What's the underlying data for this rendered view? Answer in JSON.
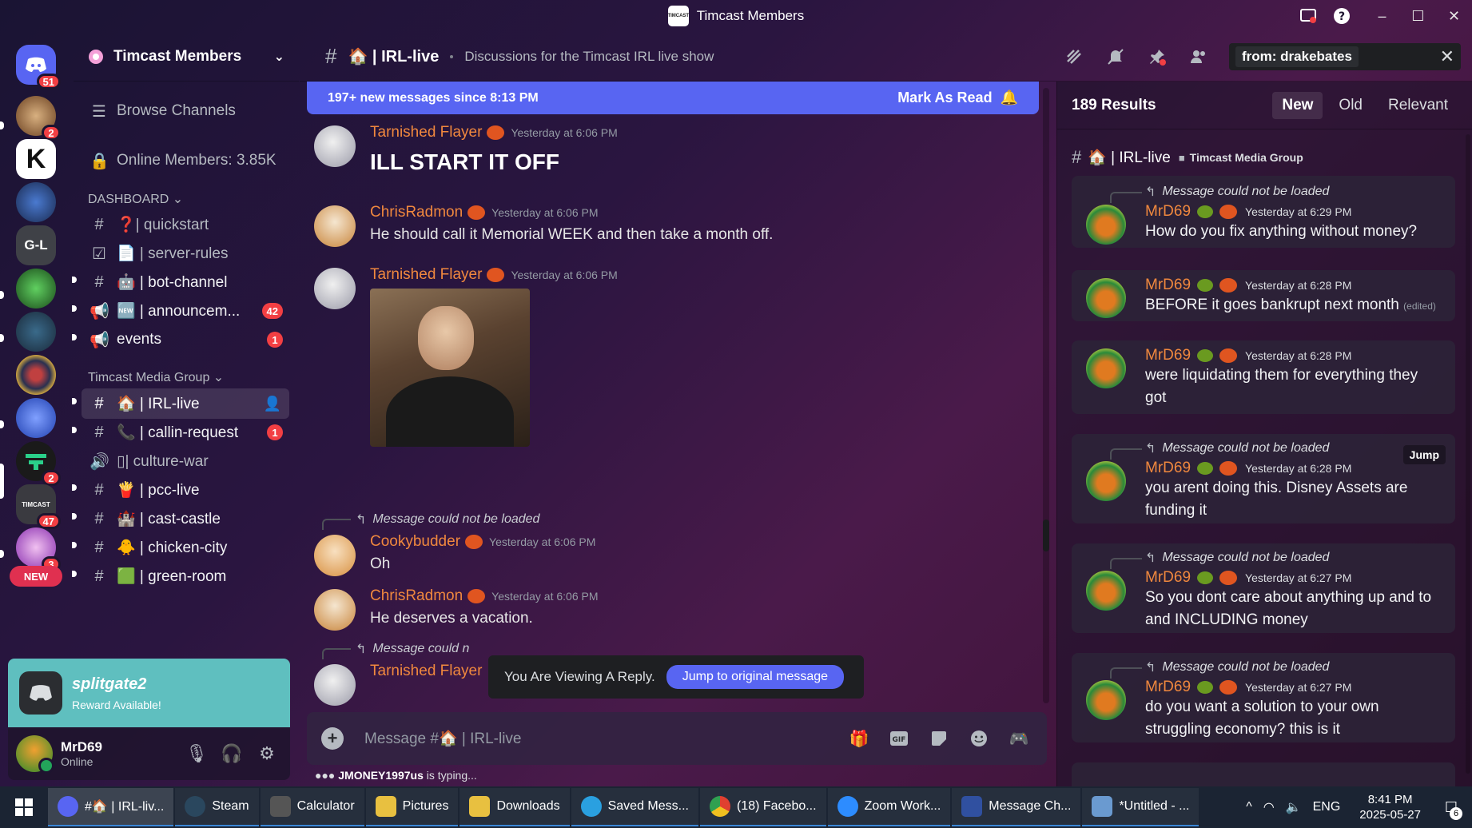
{
  "window": {
    "title": "Timcast Members",
    "logo_text": "TIMCAST",
    "minimize": "–",
    "maximize": "☐",
    "close": "✕"
  },
  "servers": [
    {
      "name": "direct-messages",
      "label": "",
      "badge": "51",
      "color": "#5865f2"
    },
    {
      "name": "server-2",
      "label": "",
      "badge": "2",
      "color": "#8a6a40"
    },
    {
      "name": "server-k",
      "label": "K",
      "badge": "",
      "color": "#ffffff"
    },
    {
      "name": "server-4",
      "label": "",
      "badge": "",
      "color": "#3a5aa0"
    },
    {
      "name": "server-gl",
      "label": "G-L",
      "badge": "",
      "color": "#3f4147"
    },
    {
      "name": "server-alien",
      "label": "",
      "badge": "",
      "color": "#2a7a3a"
    },
    {
      "name": "server-7",
      "label": "",
      "badge": "",
      "color": "#2a4a6a"
    },
    {
      "name": "server-8",
      "label": "",
      "badge": "",
      "color": "#2a3050"
    },
    {
      "name": "server-9",
      "label": "",
      "badge": "",
      "color": "#3050c0"
    },
    {
      "name": "server-10",
      "label": "",
      "badge": "2",
      "color": "#1a1a1a"
    },
    {
      "name": "server-timcast",
      "label": "TIMCAST",
      "badge": "47",
      "color": "#3a3a40"
    },
    {
      "name": "server-12",
      "label": "",
      "badge": "3",
      "color": "#a040c0"
    },
    {
      "name": "server-new",
      "label": "NEW",
      "badge": "",
      "color": "#e03050"
    }
  ],
  "sidebar": {
    "guild_name": "Timcast Members",
    "browse": "Browse Channels",
    "online_members": "Online Members: 3.85K",
    "category_dashboard": "DASHBOARD ⌄",
    "category_media": "Timcast Media Group ⌄",
    "channels": [
      {
        "icon": "#",
        "label": "❓| quickstart",
        "badge": ""
      },
      {
        "icon": "☑",
        "label": "📄 | server-rules",
        "badge": ""
      },
      {
        "icon": "#",
        "label": "🤖 | bot-channel",
        "badge": ""
      },
      {
        "icon": "📢",
        "label": "🆕 | announcem...",
        "badge": "42"
      },
      {
        "icon": "📢",
        "label": "events",
        "badge": "1"
      },
      {
        "icon": "#",
        "label": "🏠 | IRL-live",
        "badge": ""
      },
      {
        "icon": "#",
        "label": "📞 | callin-request",
        "badge": "1"
      },
      {
        "icon": "🔊",
        "label": "▯| culture-war",
        "badge": ""
      },
      {
        "icon": "#",
        "label": "🍟 | pcc-live",
        "badge": ""
      },
      {
        "icon": "#",
        "label": "🏰 | cast-castle",
        "badge": ""
      },
      {
        "icon": "#",
        "label": "🐥 | chicken-city",
        "badge": ""
      },
      {
        "icon": "#",
        "label": "🟩 | green-room",
        "badge": ""
      }
    ]
  },
  "promo": {
    "title": "splitgate2",
    "subtitle": "Reward Available!"
  },
  "user": {
    "name": "MrD69",
    "status": "Online"
  },
  "chat": {
    "channel": "🏠 | IRL-live",
    "topic": "Discussions for the Timcast IRL live show",
    "search_chip": "from: drakebates",
    "new_messages": "197+ new messages since 8:13 PM",
    "mark_read": "Mark As Read",
    "messages": [
      {
        "author": "Tarnished Flayer",
        "time": "Yesterday at 6:06 PM",
        "text": "ILL START IT OFF"
      },
      {
        "author": "ChrisRadmon",
        "time": "Yesterday at 6:06 PM",
        "text": "He should call it Memorial WEEK and then take a month off."
      },
      {
        "author": "Tarnished Flayer",
        "time": "Yesterday at 6:06 PM",
        "text": ""
      },
      {
        "reply": "Message could not be loaded",
        "author": "Cookybudder",
        "time": "Yesterday at 6:06 PM",
        "text": "Oh"
      },
      {
        "author": "ChrisRadmon",
        "time": "Yesterday at 6:06 PM",
        "text": "He deserves a vacation."
      },
      {
        "reply": "Message could n",
        "author": "Tarnished Flayer",
        "time": "",
        "text": ""
      }
    ],
    "viewing_reply": "You Are Viewing A Reply.",
    "jump_original": "Jump to original message",
    "composer_placeholder": "Message #🏠 | IRL-live",
    "typing_user": "JMONEY1997us",
    "typing_suffix": " is typing..."
  },
  "results": {
    "count": "189 Results",
    "sorts": [
      "New",
      "Old",
      "Relevant"
    ],
    "channel": "🏠 | IRL-live",
    "group": "Timcast Media Group",
    "items": [
      {
        "reply": "Message could not be loaded",
        "author": "MrD69",
        "time": "Yesterday at 6:29 PM",
        "text": "How do you fix anything without money?",
        "edited": "",
        "jump": ""
      },
      {
        "reply": "",
        "author": "MrD69",
        "time": "Yesterday at 6:28 PM",
        "text": "BEFORE it goes bankrupt next month",
        "edited": "(edited)",
        "jump": ""
      },
      {
        "reply": "",
        "author": "MrD69",
        "time": "Yesterday at 6:28 PM",
        "text": "were liquidating them for everything they got",
        "edited": "",
        "jump": ""
      },
      {
        "reply": "Message could not be loaded",
        "author": "MrD69",
        "time": "Yesterday at 6:28 PM",
        "text": "you arent doing this. Disney Assets are funding it",
        "edited": "",
        "jump": "Jump"
      },
      {
        "reply": "Message could not be loaded",
        "author": "MrD69",
        "time": "Yesterday at 6:27 PM",
        "text": "So you dont care about anything up and to and INCLUDING money",
        "edited": "",
        "jump": ""
      },
      {
        "reply": "Message could not be loaded",
        "author": "MrD69",
        "time": "Yesterday at 6:27 PM",
        "text": "do you want a solution to your own struggling economy? this is it",
        "edited": "",
        "jump": ""
      }
    ]
  },
  "taskbar": {
    "items": [
      {
        "label": "#🏠 | IRL-liv...",
        "color": "#5865f2"
      },
      {
        "label": "Steam",
        "color": "#1b2838"
      },
      {
        "label": "Calculator",
        "color": "#4a4a4a"
      },
      {
        "label": "Pictures",
        "color": "#e8c040"
      },
      {
        "label": "Downloads",
        "color": "#e8c040"
      },
      {
        "label": "Saved Mess...",
        "color": "#2aa0e0"
      },
      {
        "label": "(18) Facebo...",
        "color": "#e04030"
      },
      {
        "label": "Zoom Work...",
        "color": "#2d8cff"
      },
      {
        "label": "Message Ch...",
        "color": "#3050a0"
      },
      {
        "label": "*Untitled - ...",
        "color": "#6a9ad0"
      }
    ],
    "lang": "ENG",
    "time": "8:41 PM",
    "date": "2025-05-27",
    "notif_count": "6"
  }
}
